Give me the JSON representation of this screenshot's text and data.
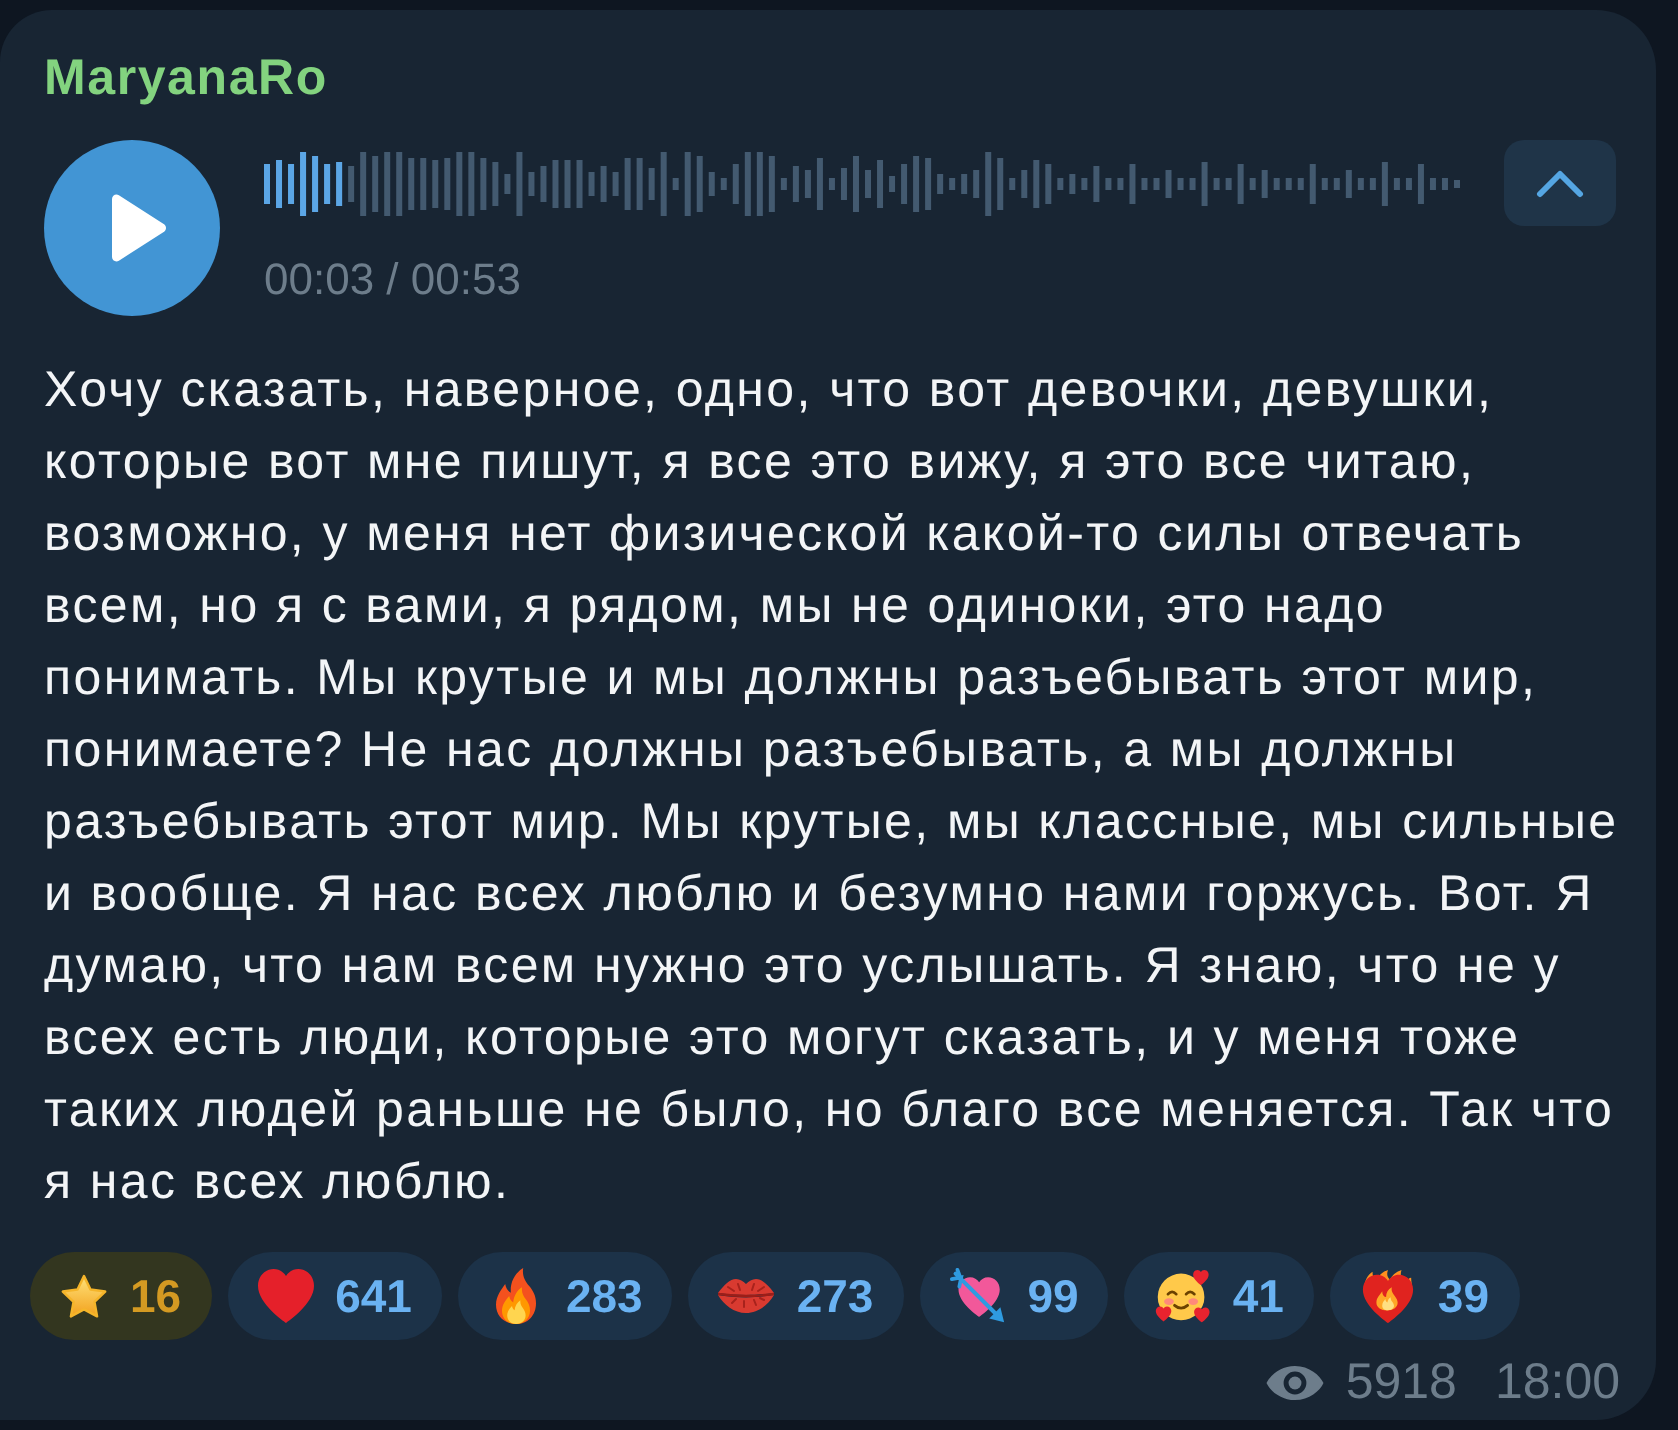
{
  "message": {
    "sender": "MaryanaRo",
    "voice": {
      "playing": false,
      "level": 0.07,
      "time": "00:03 / 00:53",
      "transcription_expanded": true
    },
    "text": "Хочу сказать, наверное, одно, что вот девочки, девушки, которые вот мне пишут, я все это вижу, я это все читаю, возможно, у меня нет физической какой-то силы отвечать всем, но я с вами, я рядом, мы не одиноки, это надо понимать. Мы крутые и мы должны разъебывать этот мир, понимаете? Не нас должны разъебывать, а мы должны разъебывать этот мир. Мы крутые, мы классные, мы сильные и вообще. Я нас всех люблю и безумно нами горжусь. Вот. Я думаю, что нам всем нужно это услышать. Я знаю, что не у всех есть люди, которые это могут сказать, и у меня тоже таких людей раньше не было, но благо все меняется. Так что я нас всех люблю.",
    "reactions": [
      {
        "kind": "star",
        "count": "16"
      },
      {
        "kind": "heart",
        "count": "641"
      },
      {
        "kind": "fire",
        "count": "283"
      },
      {
        "kind": "kiss",
        "count": "273"
      },
      {
        "kind": "heart_arrow",
        "count": "99"
      },
      {
        "kind": "smiling_hearts",
        "count": "41"
      },
      {
        "kind": "heart_fire",
        "count": "39"
      }
    ],
    "views": "5918",
    "time": "18:00"
  }
}
